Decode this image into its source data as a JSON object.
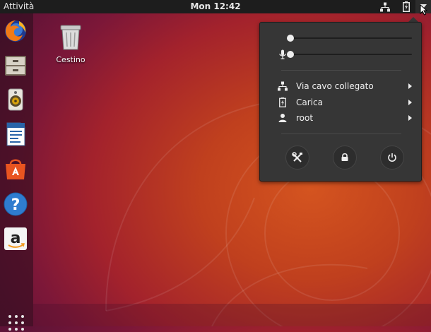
{
  "topbar": {
    "activities": "Attività",
    "clock": "Mon 12:42"
  },
  "desktop": {
    "trash_label": "Cestino"
  },
  "dock": {
    "items": [
      {
        "name": "firefox-icon",
        "running": false
      },
      {
        "name": "files-icon",
        "running": false
      },
      {
        "name": "rhythmbox-icon",
        "running": false
      },
      {
        "name": "libreoffice-writer-icon",
        "running": false
      },
      {
        "name": "software-center-icon",
        "running": false
      },
      {
        "name": "help-icon",
        "running": false
      },
      {
        "name": "amazon-icon",
        "running": false
      }
    ],
    "apps_grid": "show-applications-icon"
  },
  "system_menu": {
    "volume_level": 0.0,
    "mic_level": 0.0,
    "items": [
      {
        "label": "Via cavo collegato",
        "icon": "wired-network-icon"
      },
      {
        "label": "Carica",
        "icon": "battery-charging-icon"
      },
      {
        "label": "root",
        "icon": "user-icon"
      }
    ],
    "buttons": [
      "settings-icon",
      "lock-icon",
      "power-icon"
    ]
  },
  "colors": {
    "topbar": "#1d1d1d",
    "menu_bg": "#363636",
    "ubuntu_orange": "#e95420"
  }
}
